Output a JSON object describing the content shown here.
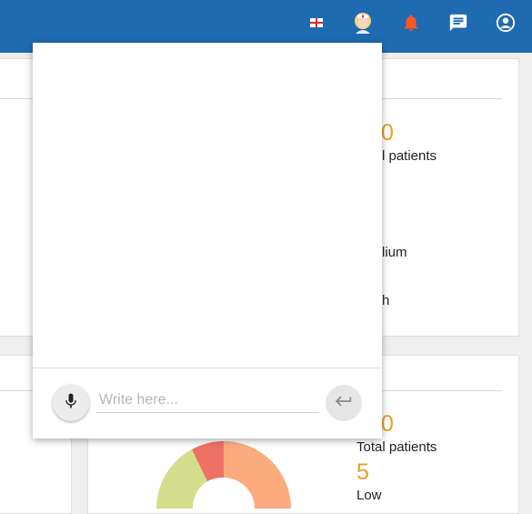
{
  "topbar": {
    "icons": [
      "english-flag-icon",
      "nurse-avatar-icon",
      "notification-bell-icon",
      "chat-icon",
      "account-icon"
    ],
    "colors": {
      "bar": "#1e6bb1",
      "bell": "#ff5722",
      "flag_red": "#d32f2f"
    }
  },
  "panel_top": {
    "total_value": "0",
    "total_label": "l patients",
    "medium_label": "lium",
    "high_label": "h"
  },
  "panel_bottom": {
    "total_value": "0",
    "total_label": "Total patients",
    "low_value": "5",
    "low_label": "Low"
  },
  "chart_data": {
    "type": "pie",
    "categories": [],
    "values": [],
    "colors": [
      "#fbab7e",
      "#d4dd8c",
      "#ee7166"
    ]
  },
  "chat": {
    "input_placeholder": "Write here...",
    "input_value": "",
    "mic_icon": "microphone-icon",
    "send_icon": "enter-return-icon"
  },
  "theme": {
    "accent_number": "#e9a126"
  }
}
